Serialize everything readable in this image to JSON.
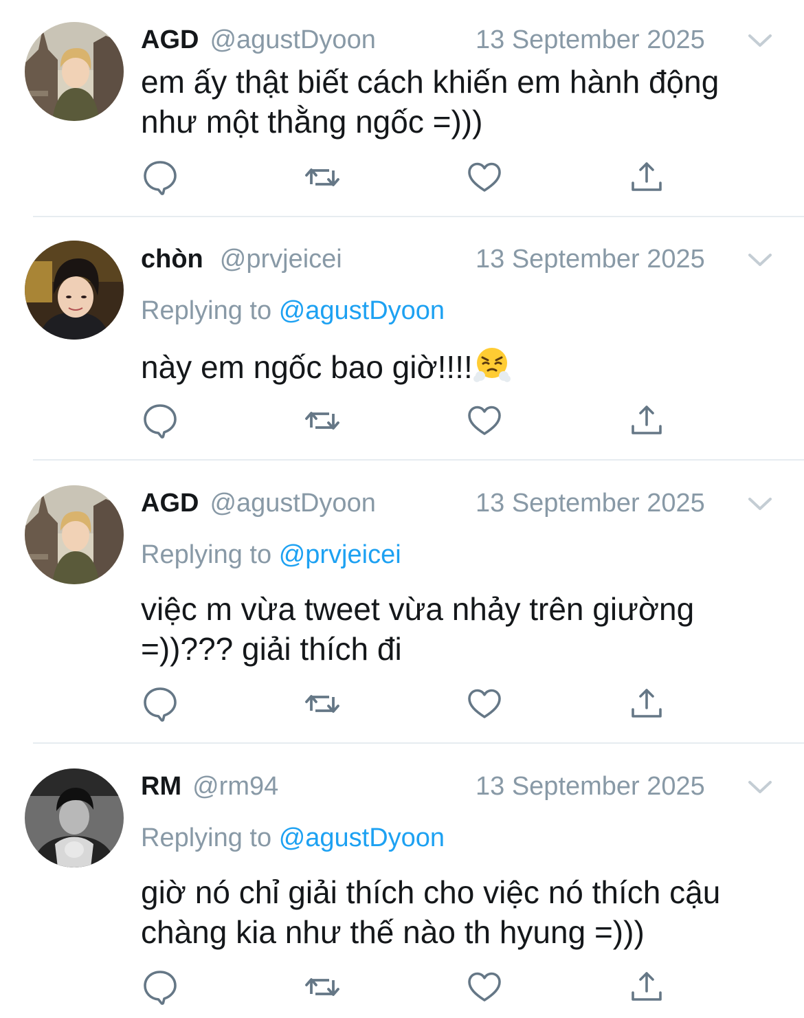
{
  "tweets": [
    {
      "name": "AGD",
      "handle": "@agustDyoon",
      "date": "13 September 2025",
      "replying_label": "",
      "replying_to": "",
      "text": "em ấy thật biết cách khiến em hành động như một thằng ngốc =)))",
      "avatar": "avatar-agd",
      "emoji": ""
    },
    {
      "name": "chòn",
      "handle": "@prvjeicei",
      "date": "13 September 2025",
      "replying_label": "Replying to",
      "replying_to": "@agustDyoon",
      "text": "này em ngốc bao giờ!!!!",
      "avatar": "avatar-chon",
      "emoji": "face-with-steam-from-nose-emoji"
    },
    {
      "name": "AGD",
      "handle": "@agustDyoon",
      "date": "13 September 2025",
      "replying_label": "Replying to",
      "replying_to": "@prvjeicei",
      "text": "việc m vừa tweet vừa nhảy trên giường =))??? giải thích đi",
      "avatar": "avatar-agd",
      "emoji": ""
    },
    {
      "name": "RM",
      "handle": "@rm94",
      "date": "13 September 2025",
      "replying_label": "Replying to",
      "replying_to": "@agustDyoon",
      "text": "giờ nó chỉ giải thích cho việc nó thích cậu chàng kia như thế nào th hyung =)))",
      "avatar": "avatar-rm",
      "emoji": ""
    }
  ],
  "icons": {
    "reply": "reply-icon",
    "retweet": "retweet-icon",
    "like": "like-icon",
    "share": "share-icon",
    "menu": "chevron-down-icon"
  },
  "colors": {
    "mention": "#1da1f2",
    "secondary_text": "#8899a6",
    "primary_text": "#14171a",
    "icon": "#657786",
    "divider": "#e6ecf0"
  }
}
